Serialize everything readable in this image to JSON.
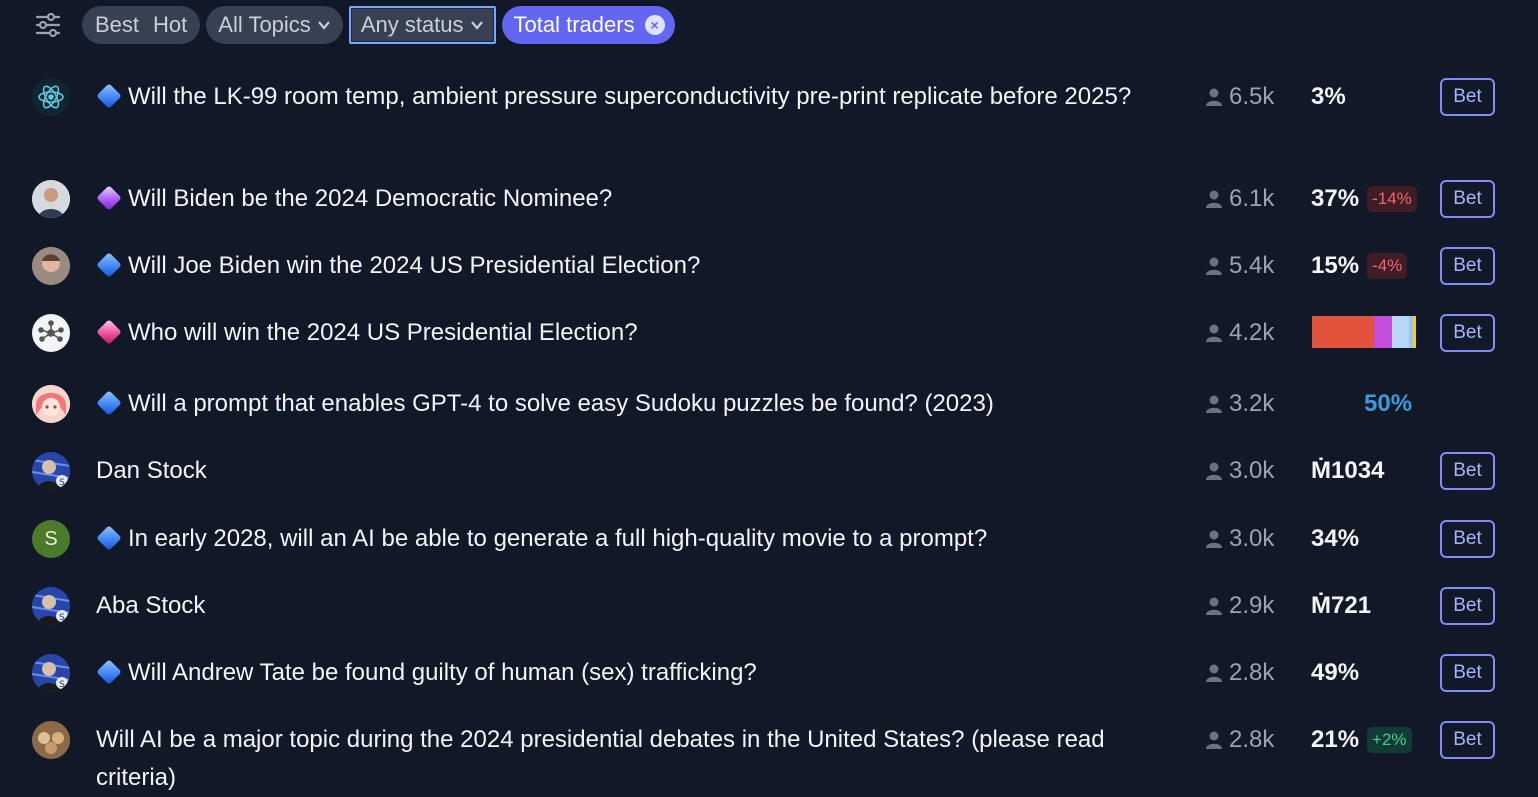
{
  "toolbar": {
    "sort": [
      "Best",
      "Hot"
    ],
    "topics": "All Topics",
    "status": "Any status",
    "active_filter": "Total traders",
    "clear_icon": "×"
  },
  "colors": {
    "background": "#111827",
    "accent": "#6366f1",
    "bet_border": "#818cf8",
    "negative": "#f4646d",
    "positive": "#34d399"
  },
  "rows": [
    {
      "title": "Will the LK-99 room temp, ambient pressure superconductivity pre-print replicate before 2025?",
      "gem": "blue",
      "traders": "6.5k",
      "prob": "3%",
      "delta": "",
      "bet": "Bet",
      "avatar": "atom-icon"
    },
    {
      "title": "Will Biden be the 2024 Democratic Nominee?",
      "gem": "purple",
      "traders": "6.1k",
      "prob": "37%",
      "delta": "-14%",
      "bet": "Bet",
      "avatar": "user-photo"
    },
    {
      "title": "Will Joe Biden win the 2024 US Presidential Election?",
      "gem": "blue",
      "traders": "5.4k",
      "prob": "15%",
      "delta": "-4%",
      "bet": "Bet",
      "avatar": "user-photo"
    },
    {
      "title": "Who will win the 2024 US Presidential Election?",
      "gem": "pink",
      "traders": "4.2k",
      "prob": "",
      "delta": "",
      "bet": "Bet",
      "avatar": "network-icon",
      "multi": [
        0.6,
        0.17,
        0.16,
        0.04,
        0.03
      ]
    },
    {
      "title": "Will a prompt that enables GPT-4 to solve easy Sudoku puzzles be found? (2023)",
      "gem": "blue",
      "traders": "3.2k",
      "prob": "50%",
      "delta": "",
      "bet": "",
      "avatar": "anime-avatar"
    },
    {
      "title": "Dan Stock",
      "gem": "",
      "traders": "3.0k",
      "prob": "Ṁ1034",
      "delta": "",
      "bet": "Bet",
      "avatar": "stock-avatar"
    },
    {
      "title": "In early 2028, will an AI be able to generate a full high-quality movie to a prompt?",
      "gem": "blue",
      "traders": "3.0k",
      "prob": "34%",
      "delta": "",
      "bet": "Bet",
      "avatar": "S"
    },
    {
      "title": "Aba Stock",
      "gem": "",
      "traders": "2.9k",
      "prob": "Ṁ721",
      "delta": "",
      "bet": "Bet",
      "avatar": "stock-avatar"
    },
    {
      "title": "Will Andrew Tate be found guilty of human (sex) trafficking?",
      "gem": "blue",
      "traders": "2.8k",
      "prob": "49%",
      "delta": "",
      "bet": "Bet",
      "avatar": "stock-avatar"
    },
    {
      "title": "Will AI be a major topic during the 2024 presidential debates in the United States? (please read criteria)",
      "gem": "",
      "traders": "2.8k",
      "prob": "21%",
      "delta": "+2%",
      "bet": "Bet",
      "avatar": "group-photo"
    }
  ]
}
